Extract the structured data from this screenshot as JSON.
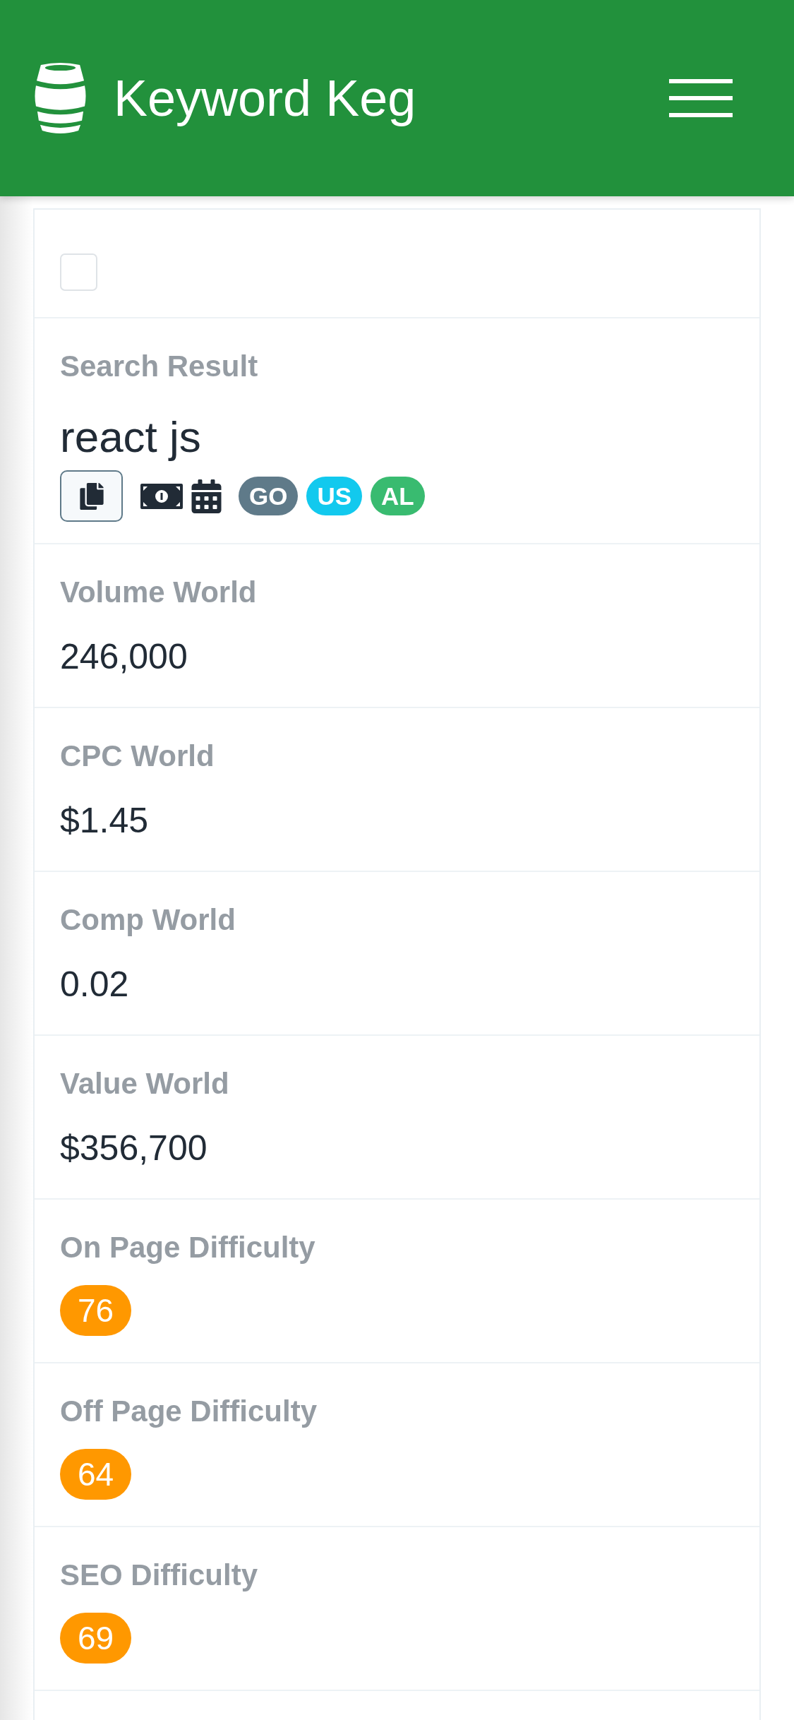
{
  "header": {
    "title": "Keyword Keg"
  },
  "select_row": {
    "checked": false
  },
  "search_result": {
    "label": "Search Result",
    "keyword": "react js",
    "tags": [
      {
        "label": "GO",
        "color": "#5f7a89"
      },
      {
        "label": "US",
        "color": "#12c9ee"
      },
      {
        "label": "AL",
        "color": "#39bb70"
      }
    ]
  },
  "metrics": [
    {
      "label": "Volume World",
      "value": "246,000",
      "kind": "text"
    },
    {
      "label": "CPC World",
      "value": "$1.45",
      "kind": "text"
    },
    {
      "label": "Comp World",
      "value": "0.02",
      "kind": "text"
    },
    {
      "label": "Value World",
      "value": "$356,700",
      "kind": "text"
    },
    {
      "label": "On Page Difficulty",
      "value": "76",
      "kind": "badge"
    },
    {
      "label": "Off Page Difficulty",
      "value": "64",
      "kind": "badge"
    },
    {
      "label": "SEO Difficulty",
      "value": "69",
      "kind": "badge"
    }
  ]
}
